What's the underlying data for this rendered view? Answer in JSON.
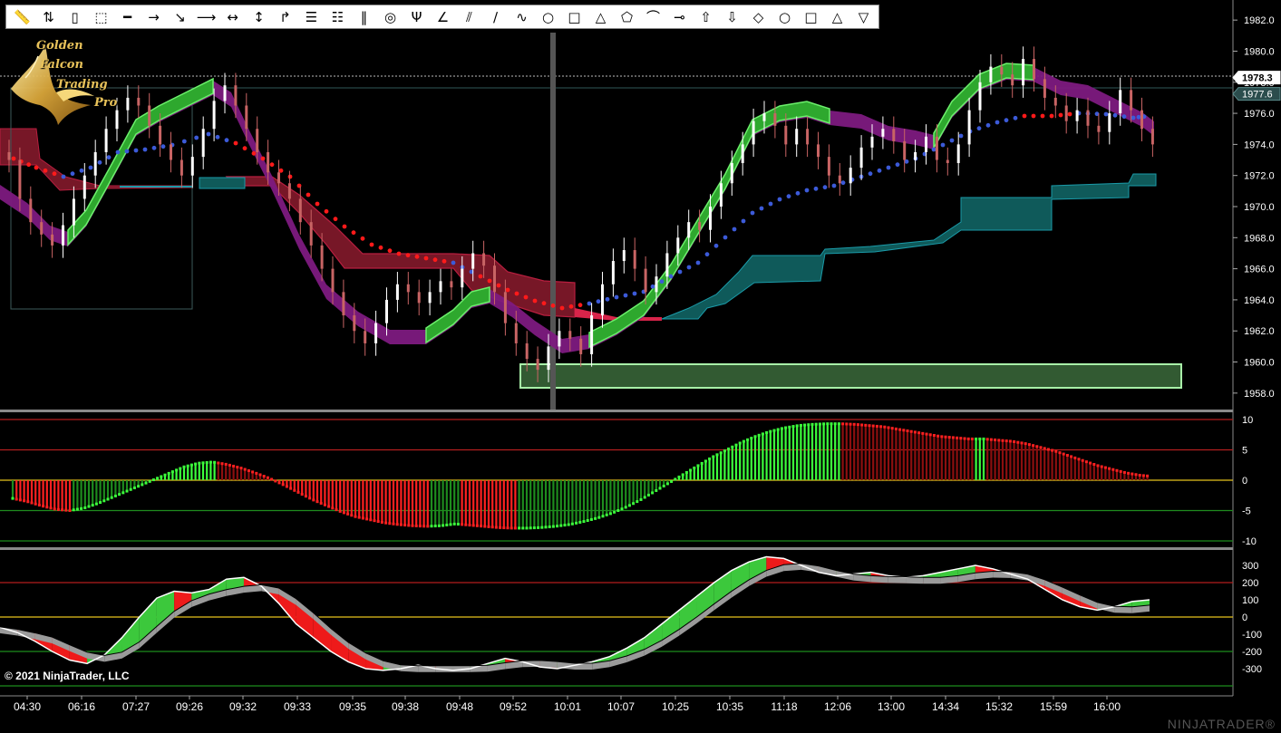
{
  "toolbar": {
    "tools": [
      {
        "name": "ruler-icon",
        "glyph": "📏"
      },
      {
        "name": "arrows-updown-icon",
        "glyph": "⇅"
      },
      {
        "name": "vertical-range-icon",
        "glyph": "▯"
      },
      {
        "name": "dotted-rect-icon",
        "glyph": "⬚"
      },
      {
        "name": "line-icon",
        "glyph": "━"
      },
      {
        "name": "ray-icon",
        "glyph": "→"
      },
      {
        "name": "diagonal-line-icon",
        "glyph": "↘"
      },
      {
        "name": "extended-line-icon",
        "glyph": "⟶"
      },
      {
        "name": "horizontal-arrow-icon",
        "glyph": "↔"
      },
      {
        "name": "vertical-arrow-icon",
        "glyph": "↕"
      },
      {
        "name": "risk-reward-icon",
        "glyph": "↱"
      },
      {
        "name": "fib-retracement-icon",
        "glyph": "☰"
      },
      {
        "name": "fib-extension-icon",
        "glyph": "☷"
      },
      {
        "name": "fib-timezone-icon",
        "glyph": "‖"
      },
      {
        "name": "fib-circle-icon",
        "glyph": "◎"
      },
      {
        "name": "andrews-pitchfork-icon",
        "glyph": "Ψ"
      },
      {
        "name": "gann-fan-icon",
        "glyph": "∠"
      },
      {
        "name": "regression-channel-icon",
        "glyph": "⫽"
      },
      {
        "name": "trend-channel-icon",
        "glyph": "∕"
      },
      {
        "name": "arc-icon",
        "glyph": "∿"
      },
      {
        "name": "ellipse-icon",
        "glyph": "○"
      },
      {
        "name": "rectangle-icon",
        "glyph": "□"
      },
      {
        "name": "triangle-icon",
        "glyph": "△"
      },
      {
        "name": "polygon-icon",
        "glyph": "⬠"
      },
      {
        "name": "arc-shape-icon",
        "glyph": "⌒"
      },
      {
        "name": "text-icon",
        "glyph": "⊸"
      },
      {
        "name": "arrow-up-icon",
        "glyph": "⇧"
      },
      {
        "name": "arrow-down-icon",
        "glyph": "⇩"
      },
      {
        "name": "diamond-icon",
        "glyph": "◇"
      },
      {
        "name": "dot-icon",
        "glyph": "○"
      },
      {
        "name": "square-icon",
        "glyph": "□"
      },
      {
        "name": "triangle-up-icon",
        "glyph": "△"
      },
      {
        "name": "triangle-down-icon",
        "glyph": "▽"
      }
    ]
  },
  "logo": {
    "line1": "Golden",
    "line2": "Falcon",
    "line3": "Trading",
    "line4": "Pro"
  },
  "price_axis": {
    "labels": [
      "1982.0",
      "1980.0",
      "1978.0",
      "1976.0",
      "1974.0",
      "1972.0",
      "1970.0",
      "1968.0",
      "1966.0",
      "1964.0",
      "1962.0",
      "1960.0",
      "1958.0"
    ],
    "last_price": "1978.3",
    "marker_price": "1977.6"
  },
  "oscillator1_axis": {
    "labels": [
      "10",
      "5",
      "0",
      "-5",
      "-10"
    ]
  },
  "oscillator2_axis": {
    "labels": [
      "300",
      "200",
      "100",
      "0",
      "-100",
      "-200",
      "-300"
    ]
  },
  "time_axis": {
    "labels": [
      "04:30",
      "06:16",
      "07:27",
      "09:26",
      "09:32",
      "09:33",
      "09:35",
      "09:38",
      "09:48",
      "09:52",
      "10:01",
      "10:07",
      "10:25",
      "10:35",
      "11:18",
      "12:06",
      "13:00",
      "14:34",
      "15:32",
      "15:59",
      "16:00"
    ]
  },
  "copyright": "© 2021 NinjaTrader, LLC",
  "brand": "NINJATRADER®",
  "colors": {
    "up_bar": "#ffffff",
    "down_bar": "#c86464",
    "green_band": "#2ea82e",
    "purple_band": "#7d1a80",
    "red_cloud": "#8c1c2e",
    "teal_cloud": "#0f5a5a",
    "red_dots": "#ff1a1a",
    "blue_dots": "#3c5ad8",
    "yellow_zero": "#e6c31e",
    "red_level": "#b41e1e",
    "green_level": "#1e8c1e"
  },
  "chart_data": {
    "type": "candlestick",
    "price_range": [
      1957,
      1983
    ],
    "close": [
      1973.0,
      1970.5,
      1969.0,
      1968.2,
      1967.5,
      1968.8,
      1970.5,
      1972.0,
      1973.5,
      1975.0,
      1976.2,
      1977.0,
      1976.5,
      1975.2,
      1974.0,
      1973.0,
      1972.0,
      1973.2,
      1975.0,
      1976.8,
      1977.8,
      1976.5,
      1975.0,
      1973.5,
      1972.2,
      1971.5,
      1970.5,
      1969.0,
      1967.5,
      1966.0,
      1964.5,
      1963.0,
      1962.0,
      1961.2,
      1962.5,
      1964.0,
      1965.0,
      1964.5,
      1963.8,
      1964.5,
      1965.2,
      1964.8,
      1966.0,
      1967.0,
      1966.2,
      1964.5,
      1962.5,
      1961.2,
      1960.2,
      1959.5,
      1961.0,
      1962.0,
      1961.5,
      1960.5,
      1963.0,
      1965.0,
      1966.5,
      1967.2,
      1966.0,
      1964.5,
      1965.5,
      1967.0,
      1968.0,
      1969.0,
      1968.5,
      1970.0,
      1971.5,
      1972.8,
      1974.0,
      1975.5,
      1976.0,
      1975.2,
      1974.0,
      1975.0,
      1974.0,
      1973.2,
      1972.0,
      1971.5,
      1972.5,
      1973.8,
      1974.5,
      1975.0,
      1974.2,
      1973.0,
      1973.5,
      1974.5,
      1973.0,
      1972.8,
      1974.0,
      1976.2,
      1978.0,
      1979.0,
      1978.5,
      1977.8,
      1979.5,
      1978.2,
      1977.0,
      1976.5,
      1975.5,
      1976.2,
      1975.2,
      1974.8,
      1976.0,
      1977.5,
      1976.2,
      1975.0,
      1974.0,
      1975.8,
      1977.5,
      1978.0
    ],
    "osc1_values": [
      -3.0,
      -3.5,
      -4.2,
      -4.8,
      -5.0,
      -4.6,
      -3.8,
      -2.8,
      -1.8,
      -0.8,
      0.2,
      1.2,
      2.2,
      2.8,
      3.0,
      2.6,
      2.0,
      1.2,
      0.3,
      -0.8,
      -2.0,
      -3.2,
      -4.2,
      -5.2,
      -6.0,
      -6.5,
      -7.0,
      -7.3,
      -7.5,
      -7.6,
      -7.5,
      -7.2,
      -7.4,
      -7.6,
      -7.8,
      -7.9,
      -7.9,
      -7.8,
      -7.6,
      -7.3,
      -6.8,
      -6.2,
      -5.4,
      -4.4,
      -3.2,
      -1.8,
      -0.4,
      1.0,
      2.4,
      3.8,
      5.0,
      6.2,
      7.2,
      8.0,
      8.6,
      9.0,
      9.2,
      9.3,
      9.3,
      9.2,
      9.0,
      8.8,
      8.4,
      8.0,
      7.6,
      7.2,
      7.0,
      6.8,
      6.8,
      6.6,
      6.4,
      6.0,
      5.4,
      4.8,
      4.0,
      3.2,
      2.4,
      1.8,
      1.2,
      0.8,
      0.6
    ],
    "osc2_values": [
      -60,
      -90,
      -140,
      -200,
      -250,
      -270,
      -220,
      -120,
      0,
      110,
      150,
      140,
      160,
      220,
      230,
      180,
      80,
      -40,
      -120,
      -200,
      -260,
      -300,
      -310,
      -300,
      -280,
      -300,
      -310,
      -300,
      -270,
      -240,
      -260,
      -290,
      -300,
      -280,
      -260,
      -230,
      -180,
      -120,
      -40,
      40,
      120,
      200,
      270,
      320,
      350,
      340,
      300,
      260,
      240,
      250,
      260,
      240,
      230,
      240,
      260,
      280,
      300,
      280,
      250,
      220,
      160,
      100,
      60,
      40,
      60,
      90,
      100
    ]
  }
}
